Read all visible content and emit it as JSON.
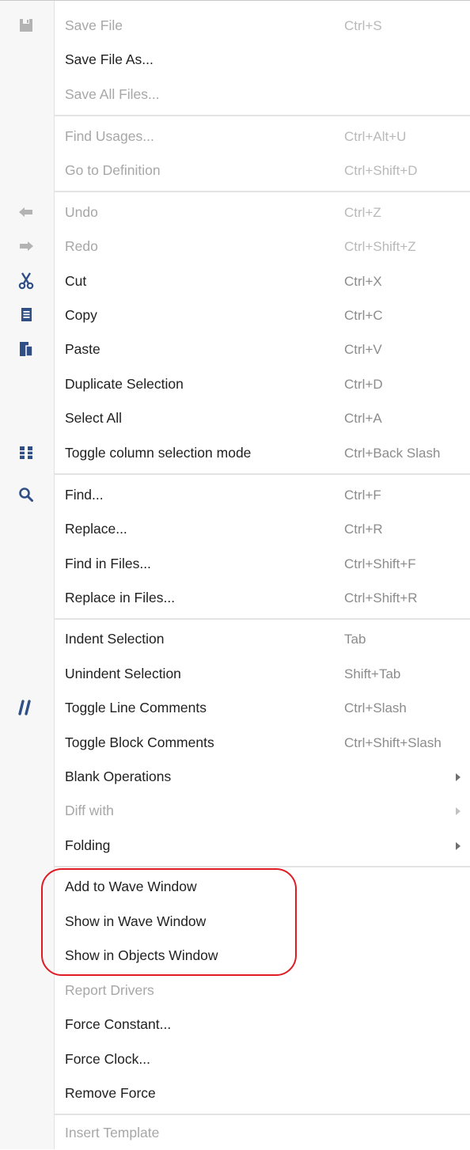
{
  "menu": {
    "items": [
      {
        "label": "Save File",
        "shortcut": "Ctrl+S",
        "enabled": false,
        "icon": "save-icon"
      },
      {
        "label": "Save File As...",
        "shortcut": "",
        "enabled": true
      },
      {
        "label": "Save All Files...",
        "shortcut": "",
        "enabled": false
      },
      {
        "label": "Find Usages...",
        "shortcut": "Ctrl+Alt+U",
        "enabled": false
      },
      {
        "label": "Go to Definition",
        "shortcut": "Ctrl+Shift+D",
        "enabled": false
      },
      {
        "label": "Undo",
        "shortcut": "Ctrl+Z",
        "enabled": false,
        "icon": "undo-icon"
      },
      {
        "label": "Redo",
        "shortcut": "Ctrl+Shift+Z",
        "enabled": false,
        "icon": "redo-icon"
      },
      {
        "label": "Cut",
        "shortcut": "Ctrl+X",
        "enabled": true,
        "icon": "cut-icon"
      },
      {
        "label": "Copy",
        "shortcut": "Ctrl+C",
        "enabled": true,
        "icon": "copy-icon"
      },
      {
        "label": "Paste",
        "shortcut": "Ctrl+V",
        "enabled": true,
        "icon": "paste-icon"
      },
      {
        "label": "Duplicate Selection",
        "shortcut": "Ctrl+D",
        "enabled": true
      },
      {
        "label": "Select All",
        "shortcut": "Ctrl+A",
        "enabled": true
      },
      {
        "label": "Toggle column selection mode",
        "shortcut": "Ctrl+Back Slash",
        "enabled": true,
        "icon": "column-selection-icon"
      },
      {
        "label": "Find...",
        "shortcut": "Ctrl+F",
        "enabled": true,
        "icon": "search-icon"
      },
      {
        "label": "Replace...",
        "shortcut": "Ctrl+R",
        "enabled": true
      },
      {
        "label": "Find in Files...",
        "shortcut": "Ctrl+Shift+F",
        "enabled": true
      },
      {
        "label": "Replace in Files...",
        "shortcut": "Ctrl+Shift+R",
        "enabled": true
      },
      {
        "label": "Indent Selection",
        "shortcut": "Tab",
        "enabled": true
      },
      {
        "label": "Unindent Selection",
        "shortcut": "Shift+Tab",
        "enabled": true
      },
      {
        "label": "Toggle Line Comments",
        "shortcut": "Ctrl+Slash",
        "enabled": true,
        "icon": "comment-icon"
      },
      {
        "label": "Toggle Block Comments",
        "shortcut": "Ctrl+Shift+Slash",
        "enabled": true
      },
      {
        "label": "Blank Operations",
        "shortcut": "",
        "enabled": true,
        "submenu": true
      },
      {
        "label": "Diff with",
        "shortcut": "",
        "enabled": false,
        "submenu": true
      },
      {
        "label": "Folding",
        "shortcut": "",
        "enabled": true,
        "submenu": true
      },
      {
        "label": "Add to Wave Window",
        "shortcut": "",
        "enabled": true
      },
      {
        "label": "Show in Wave Window",
        "shortcut": "",
        "enabled": true
      },
      {
        "label": "Show in Objects Window",
        "shortcut": "",
        "enabled": true
      },
      {
        "label": "Report Drivers",
        "shortcut": "",
        "enabled": false
      },
      {
        "label": "Force Constant...",
        "shortcut": "",
        "enabled": true
      },
      {
        "label": "Force Clock...",
        "shortcut": "",
        "enabled": true
      },
      {
        "label": "Remove Force",
        "shortcut": "",
        "enabled": true
      },
      {
        "label": "Insert Template",
        "shortcut": "",
        "enabled": false
      }
    ]
  },
  "colors": {
    "accent_icon": "#2f4f86",
    "highlight_circle": "#e01b24"
  }
}
